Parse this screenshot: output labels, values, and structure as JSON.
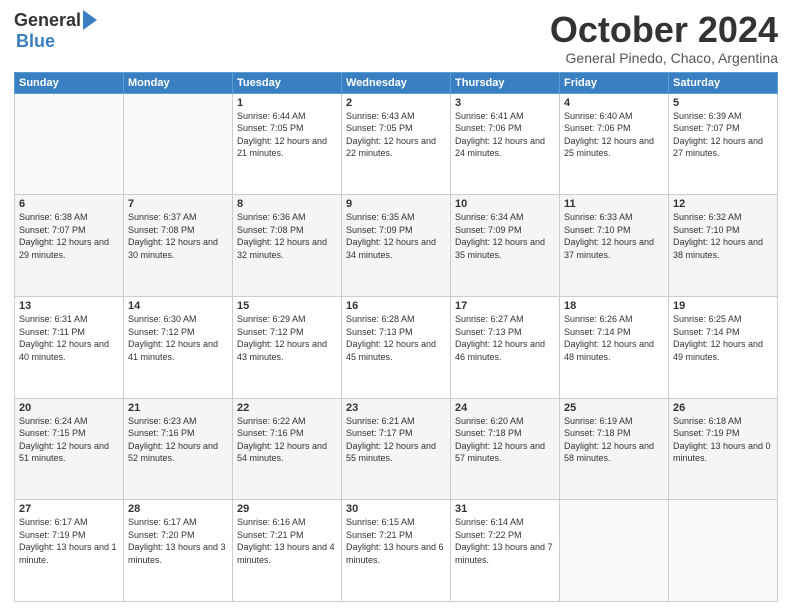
{
  "logo": {
    "general": "General",
    "blue": "Blue"
  },
  "header": {
    "month": "October 2024",
    "location": "General Pinedo, Chaco, Argentina"
  },
  "weekdays": [
    "Sunday",
    "Monday",
    "Tuesday",
    "Wednesday",
    "Thursday",
    "Friday",
    "Saturday"
  ],
  "weeks": [
    [
      {
        "day": "",
        "info": ""
      },
      {
        "day": "",
        "info": ""
      },
      {
        "day": "1",
        "info": "Sunrise: 6:44 AM\nSunset: 7:05 PM\nDaylight: 12 hours and 21 minutes."
      },
      {
        "day": "2",
        "info": "Sunrise: 6:43 AM\nSunset: 7:05 PM\nDaylight: 12 hours and 22 minutes."
      },
      {
        "day": "3",
        "info": "Sunrise: 6:41 AM\nSunset: 7:06 PM\nDaylight: 12 hours and 24 minutes."
      },
      {
        "day": "4",
        "info": "Sunrise: 6:40 AM\nSunset: 7:06 PM\nDaylight: 12 hours and 25 minutes."
      },
      {
        "day": "5",
        "info": "Sunrise: 6:39 AM\nSunset: 7:07 PM\nDaylight: 12 hours and 27 minutes."
      }
    ],
    [
      {
        "day": "6",
        "info": "Sunrise: 6:38 AM\nSunset: 7:07 PM\nDaylight: 12 hours and 29 minutes."
      },
      {
        "day": "7",
        "info": "Sunrise: 6:37 AM\nSunset: 7:08 PM\nDaylight: 12 hours and 30 minutes."
      },
      {
        "day": "8",
        "info": "Sunrise: 6:36 AM\nSunset: 7:08 PM\nDaylight: 12 hours and 32 minutes."
      },
      {
        "day": "9",
        "info": "Sunrise: 6:35 AM\nSunset: 7:09 PM\nDaylight: 12 hours and 34 minutes."
      },
      {
        "day": "10",
        "info": "Sunrise: 6:34 AM\nSunset: 7:09 PM\nDaylight: 12 hours and 35 minutes."
      },
      {
        "day": "11",
        "info": "Sunrise: 6:33 AM\nSunset: 7:10 PM\nDaylight: 12 hours and 37 minutes."
      },
      {
        "day": "12",
        "info": "Sunrise: 6:32 AM\nSunset: 7:10 PM\nDaylight: 12 hours and 38 minutes."
      }
    ],
    [
      {
        "day": "13",
        "info": "Sunrise: 6:31 AM\nSunset: 7:11 PM\nDaylight: 12 hours and 40 minutes."
      },
      {
        "day": "14",
        "info": "Sunrise: 6:30 AM\nSunset: 7:12 PM\nDaylight: 12 hours and 41 minutes."
      },
      {
        "day": "15",
        "info": "Sunrise: 6:29 AM\nSunset: 7:12 PM\nDaylight: 12 hours and 43 minutes."
      },
      {
        "day": "16",
        "info": "Sunrise: 6:28 AM\nSunset: 7:13 PM\nDaylight: 12 hours and 45 minutes."
      },
      {
        "day": "17",
        "info": "Sunrise: 6:27 AM\nSunset: 7:13 PM\nDaylight: 12 hours and 46 minutes."
      },
      {
        "day": "18",
        "info": "Sunrise: 6:26 AM\nSunset: 7:14 PM\nDaylight: 12 hours and 48 minutes."
      },
      {
        "day": "19",
        "info": "Sunrise: 6:25 AM\nSunset: 7:14 PM\nDaylight: 12 hours and 49 minutes."
      }
    ],
    [
      {
        "day": "20",
        "info": "Sunrise: 6:24 AM\nSunset: 7:15 PM\nDaylight: 12 hours and 51 minutes."
      },
      {
        "day": "21",
        "info": "Sunrise: 6:23 AM\nSunset: 7:16 PM\nDaylight: 12 hours and 52 minutes."
      },
      {
        "day": "22",
        "info": "Sunrise: 6:22 AM\nSunset: 7:16 PM\nDaylight: 12 hours and 54 minutes."
      },
      {
        "day": "23",
        "info": "Sunrise: 6:21 AM\nSunset: 7:17 PM\nDaylight: 12 hours and 55 minutes."
      },
      {
        "day": "24",
        "info": "Sunrise: 6:20 AM\nSunset: 7:18 PM\nDaylight: 12 hours and 57 minutes."
      },
      {
        "day": "25",
        "info": "Sunrise: 6:19 AM\nSunset: 7:18 PM\nDaylight: 12 hours and 58 minutes."
      },
      {
        "day": "26",
        "info": "Sunrise: 6:18 AM\nSunset: 7:19 PM\nDaylight: 13 hours and 0 minutes."
      }
    ],
    [
      {
        "day": "27",
        "info": "Sunrise: 6:17 AM\nSunset: 7:19 PM\nDaylight: 13 hours and 1 minute."
      },
      {
        "day": "28",
        "info": "Sunrise: 6:17 AM\nSunset: 7:20 PM\nDaylight: 13 hours and 3 minutes."
      },
      {
        "day": "29",
        "info": "Sunrise: 6:16 AM\nSunset: 7:21 PM\nDaylight: 13 hours and 4 minutes."
      },
      {
        "day": "30",
        "info": "Sunrise: 6:15 AM\nSunset: 7:21 PM\nDaylight: 13 hours and 6 minutes."
      },
      {
        "day": "31",
        "info": "Sunrise: 6:14 AM\nSunset: 7:22 PM\nDaylight: 13 hours and 7 minutes."
      },
      {
        "day": "",
        "info": ""
      },
      {
        "day": "",
        "info": ""
      }
    ]
  ]
}
